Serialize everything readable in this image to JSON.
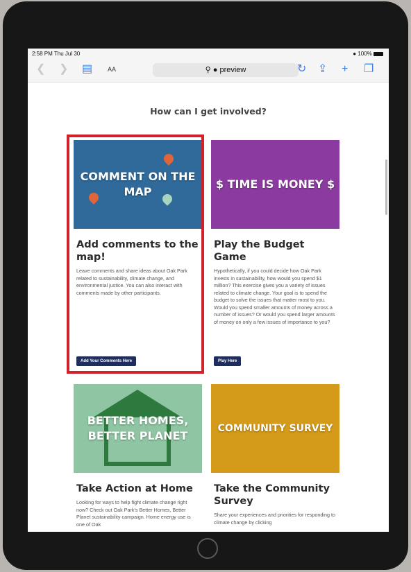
{
  "status": {
    "time": "2:58 PM  Thu Jul 30",
    "battery": "100%"
  },
  "browser": {
    "text_size": "AA",
    "url": "preview"
  },
  "page": {
    "heading": "How can I get involved?",
    "cards": [
      {
        "image_text": "COMMENT ON THE MAP",
        "title": "Add comments to the map!",
        "description": "Leave comments and share ideas about Oak Park related to sustainability, climate change, and environmental justice. You can also interact with comments made by other participants.",
        "button": "Add Your Comments Here",
        "image_color": "#2f6a9a"
      },
      {
        "image_text": "$ TIME IS MONEY $",
        "title": "Play the Budget Game",
        "description": "Hypothetically, if you could decide how Oak Park invests in sustainability, how would you spend $1 million? This exercise gives you a variety of issues related to climate change. Your goal is to spend the budget to solve the issues that matter most to you. Would you spend smaller amounts of money across a number of issues? Or would you spend larger amounts of money on only a few issues of importance to you?",
        "button": "Play Here",
        "image_color": "#8b3aa0"
      },
      {
        "image_text": "BETTER HOMES, BETTER PLANET",
        "title": "Take Action at Home",
        "description": "Looking for ways to help fight climate change right now? Check out Oak Park's Better Homes, Better Planet sustainability campaign. Home energy use is one of Oak",
        "image_color": "#8fc5a3"
      },
      {
        "image_text": "COMMUNITY SURVEY",
        "title": "Take the Community Survey",
        "description": "Share your experiences and priorities for responding to climate change by clicking",
        "image_color": "#d49a1a"
      }
    ]
  },
  "colors": {
    "highlight": "#d0222b",
    "button": "#1f2d5c",
    "ios_blue": "#3a7ee8"
  }
}
